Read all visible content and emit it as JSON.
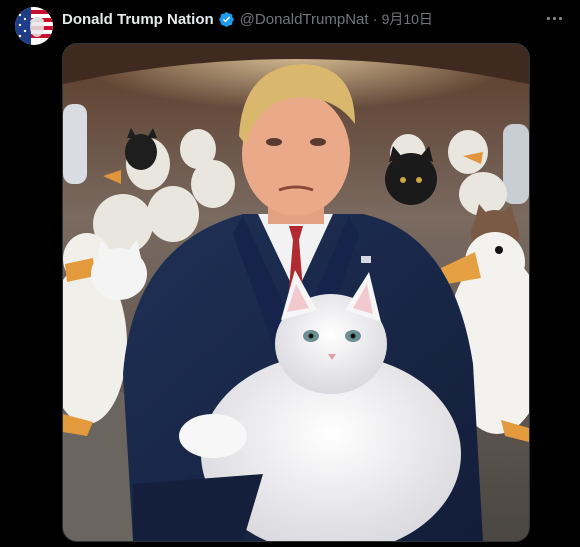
{
  "post": {
    "author": {
      "display_name": "Donald Trump Nation",
      "handle": "@DonaldTrumpNat",
      "verified": true,
      "avatar_icon": "us-flag-portrait-avatar"
    },
    "separator": "·",
    "date": "9月10日",
    "more_icon": "more-horizontal-icon",
    "image": {
      "description_icon": "ai-generated-image"
    }
  },
  "colors": {
    "background": "#000000",
    "name": "#e7e9ea",
    "secondary": "#71767b",
    "verified": "#1d9bf0"
  }
}
